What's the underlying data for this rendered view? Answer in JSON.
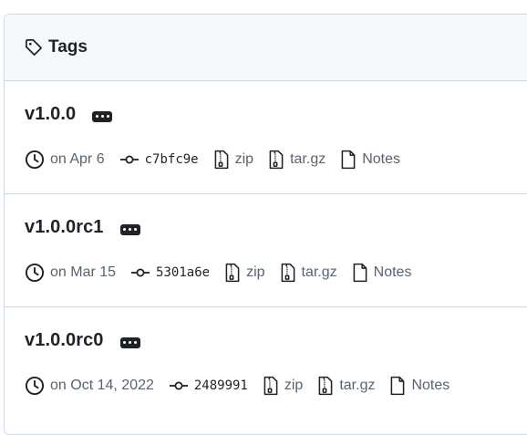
{
  "header": {
    "icon": "tag-icon",
    "title": "Tags"
  },
  "tags": [
    {
      "name": "v1.0.0",
      "date": "on Apr 6",
      "commit": "c7bfc9e",
      "zip_label": "zip",
      "targz_label": "tar.gz",
      "notes_label": "Notes"
    },
    {
      "name": "v1.0.0rc1",
      "date": "on Mar 15",
      "commit": "5301a6e",
      "zip_label": "zip",
      "targz_label": "tar.gz",
      "notes_label": "Notes"
    },
    {
      "name": "v1.0.0rc0",
      "date": "on Oct 14, 2022",
      "commit": "2489991",
      "zip_label": "zip",
      "targz_label": "tar.gz",
      "notes_label": "Notes"
    }
  ],
  "icons": {
    "clock": "clock-icon",
    "commit": "git-commit-icon",
    "zip": "file-zip-icon",
    "notes": "file-icon",
    "more": "kebab-horizontal-icon"
  },
  "colors": {
    "header_bg": "#f6f8fa",
    "border": "#d1d9e0",
    "text": "#1f2328",
    "muted": "#59636e"
  }
}
